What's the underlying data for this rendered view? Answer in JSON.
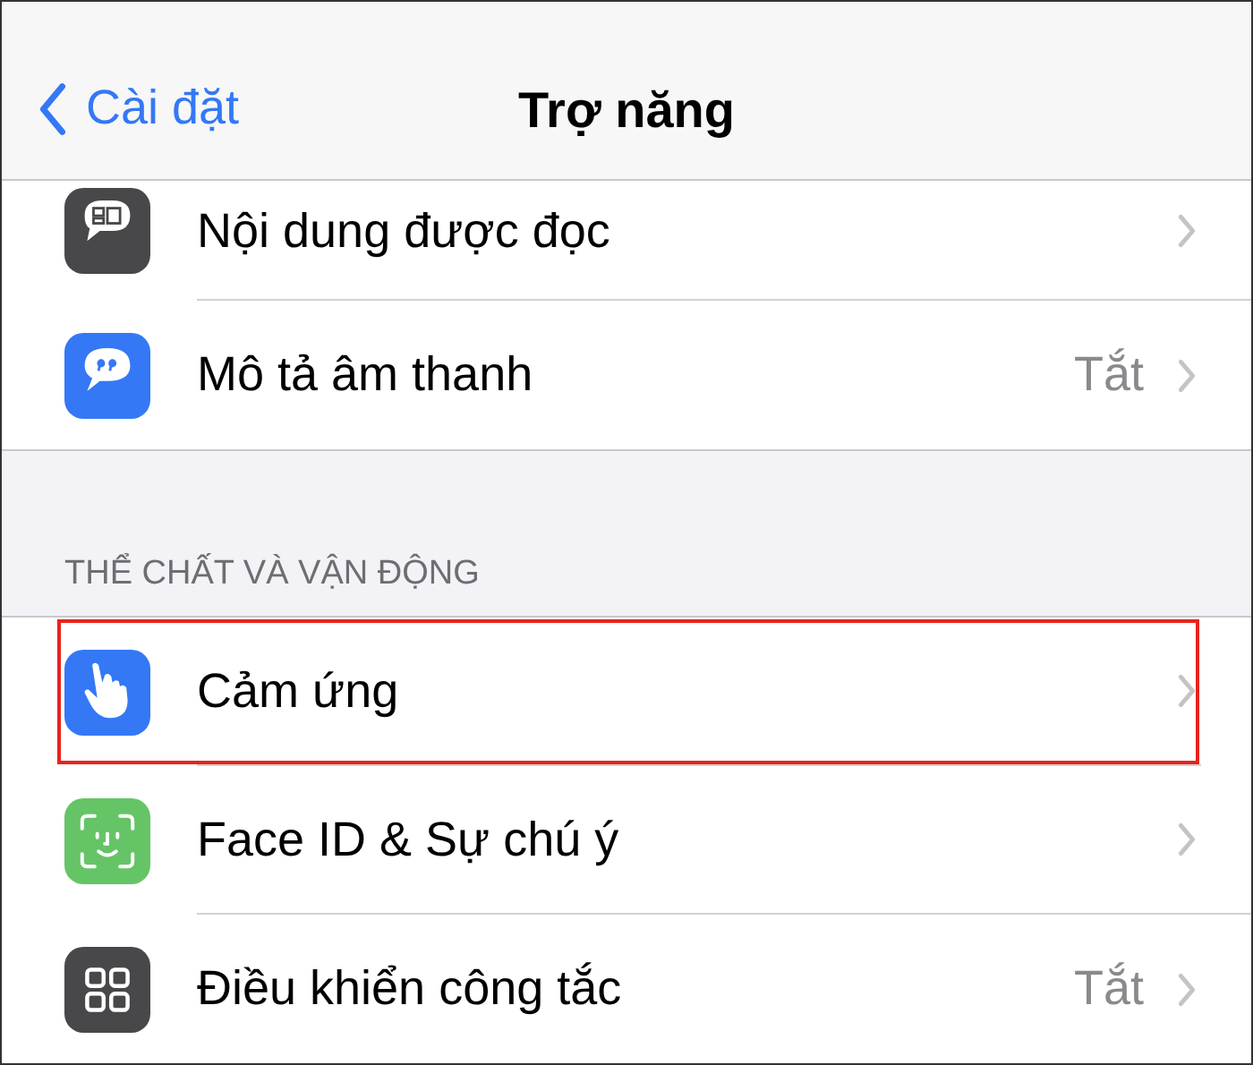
{
  "nav_bar": {
    "back_label": "Cài đặt",
    "title": "Trợ năng"
  },
  "groups": [
    {
      "items": [
        {
          "label": "Nội dung được đọc",
          "color": "#48484a",
          "highlighted": false
        },
        {
          "label": "Mô tả âm thanh",
          "value": "Tắt",
          "color": "#3478f6",
          "highlighted": false
        }
      ]
    },
    {
      "header": "THỂ CHẤT VÀ VẬN ĐỘNG",
      "items": [
        {
          "label": "Cảm ứng",
          "color": "#3478f6",
          "highlighted": true
        },
        {
          "label": "Face ID & Sự chú ý",
          "color": "#65c466",
          "highlighted": false
        },
        {
          "label": "Điều khiển công tắc",
          "value": "Tắt",
          "color": "#48484a",
          "highlighted": false
        }
      ]
    }
  ]
}
